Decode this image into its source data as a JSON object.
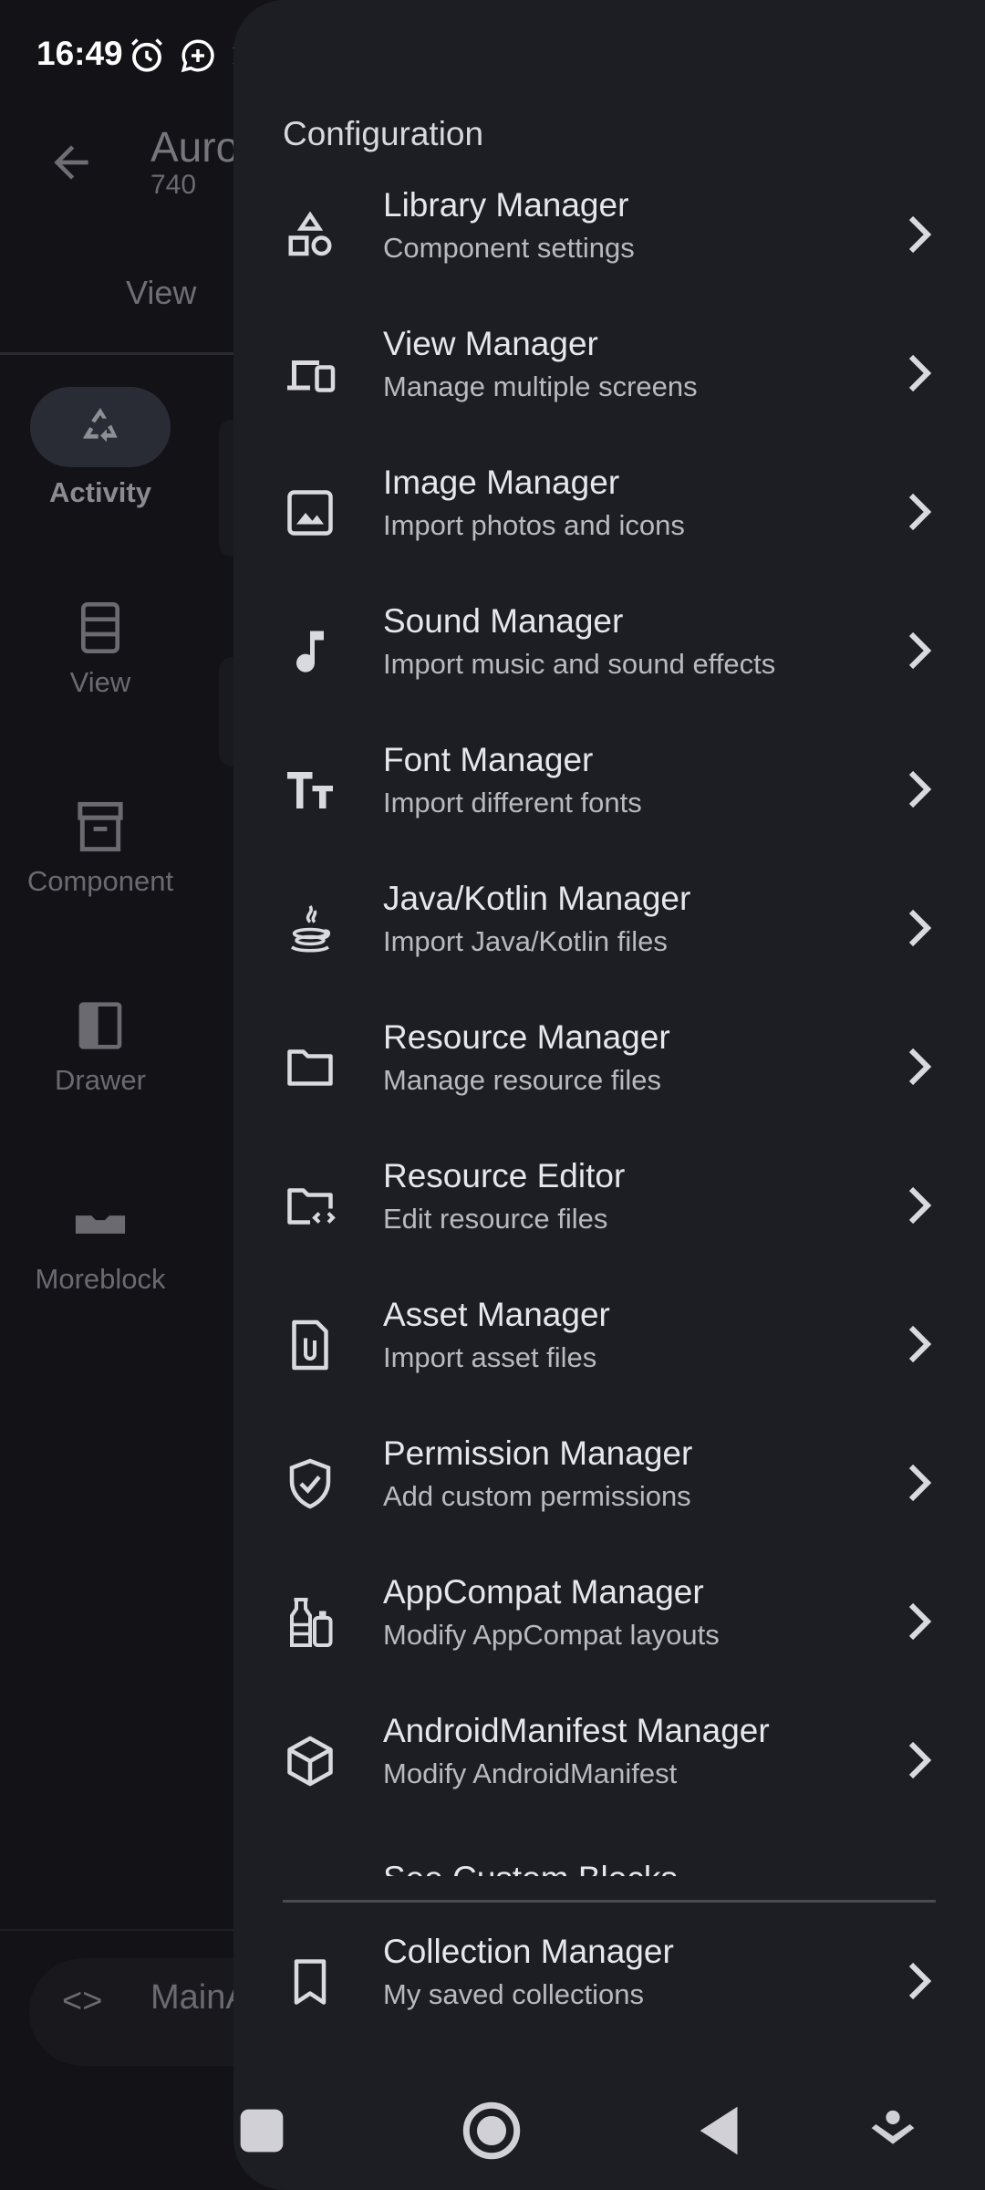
{
  "status": {
    "time": "16:49"
  },
  "background": {
    "title": "Auro",
    "subtitle": "740",
    "tab": "View",
    "rail": [
      {
        "label": "Activity",
        "icon": "recycle-icon",
        "active": true
      },
      {
        "label": "View",
        "icon": "view-list-icon",
        "active": false
      },
      {
        "label": "Component",
        "icon": "archive-icon",
        "active": false
      },
      {
        "label": "Drawer",
        "icon": "drawer-icon",
        "active": false
      },
      {
        "label": "Moreblock",
        "icon": "moreblock-icon",
        "active": false
      }
    ],
    "bottom": {
      "code_icon": "<>",
      "text": "MainA"
    }
  },
  "drawer": {
    "header": "Configuration",
    "items": [
      {
        "title": "Library Manager",
        "subtitle": "Component settings",
        "icon": "shapes-icon"
      },
      {
        "title": "View Manager",
        "subtitle": "Manage multiple screens",
        "icon": "devices-icon"
      },
      {
        "title": "Image Manager",
        "subtitle": "Import photos and icons",
        "icon": "image-icon"
      },
      {
        "title": "Sound Manager",
        "subtitle": "Import music and sound effects",
        "icon": "music-note-icon"
      },
      {
        "title": "Font Manager",
        "subtitle": "Import different fonts",
        "icon": "text-size-icon"
      },
      {
        "title": "Java/Kotlin Manager",
        "subtitle": "Import Java/Kotlin files",
        "icon": "java-icon"
      },
      {
        "title": "Resource Manager",
        "subtitle": "Manage resource files",
        "icon": "folder-icon"
      },
      {
        "title": "Resource Editor",
        "subtitle": "Edit resource files",
        "icon": "folder-code-icon"
      },
      {
        "title": "Asset Manager",
        "subtitle": "Import asset files",
        "icon": "attachment-file-icon"
      },
      {
        "title": "Permission Manager",
        "subtitle": "Add custom permissions",
        "icon": "shield-check-icon"
      },
      {
        "title": "AppCompat Manager",
        "subtitle": "Modify AppCompat layouts",
        "icon": "bottles-icon"
      },
      {
        "title": "AndroidManifest Manager",
        "subtitle": "Modify AndroidManifest",
        "icon": "cube-icon"
      }
    ],
    "partial_item": {
      "title": "See Custom Blocks"
    },
    "footer_item": {
      "title": "Collection Manager",
      "subtitle": "My saved collections",
      "icon": "bookmark-icon"
    }
  },
  "colors": {
    "drawer_bg": "#1d1e23",
    "scrim_bg": "#121217",
    "battery": "#e8a93a"
  }
}
